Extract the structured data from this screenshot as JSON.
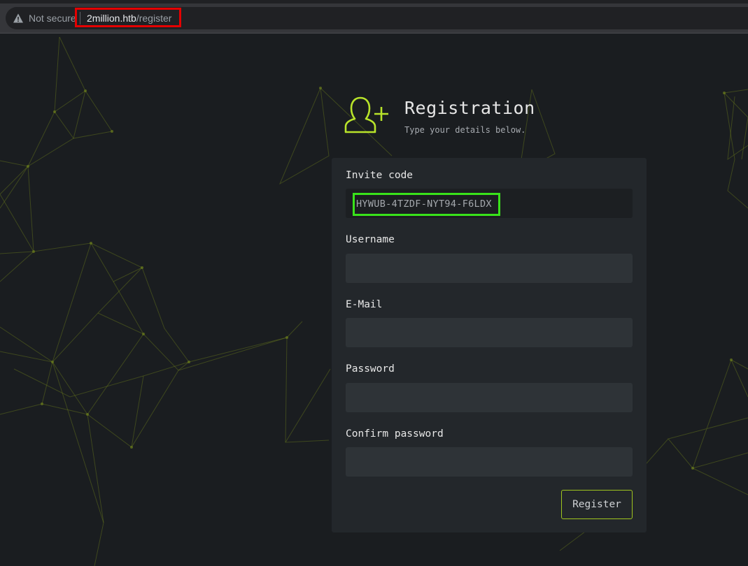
{
  "browser": {
    "security_label": "Not secure",
    "url_host": "2million.htb",
    "url_path": "/register"
  },
  "header": {
    "title": "Registration",
    "subtitle": "Type your details below.",
    "icon": "add-user-icon",
    "accent_color": "#b8e32a"
  },
  "form": {
    "fields": [
      {
        "label": "Invite code",
        "value": "HYWUB-4TZDF-NYT94-F6LDX"
      },
      {
        "label": "Username",
        "value": ""
      },
      {
        "label": "E-Mail",
        "value": ""
      },
      {
        "label": "Password",
        "value": ""
      },
      {
        "label": "Confirm password",
        "value": ""
      }
    ],
    "submit_label": "Register"
  },
  "annotations": {
    "url_highlight_color": "#e50000",
    "invite_highlight_color": "#39e31a"
  }
}
